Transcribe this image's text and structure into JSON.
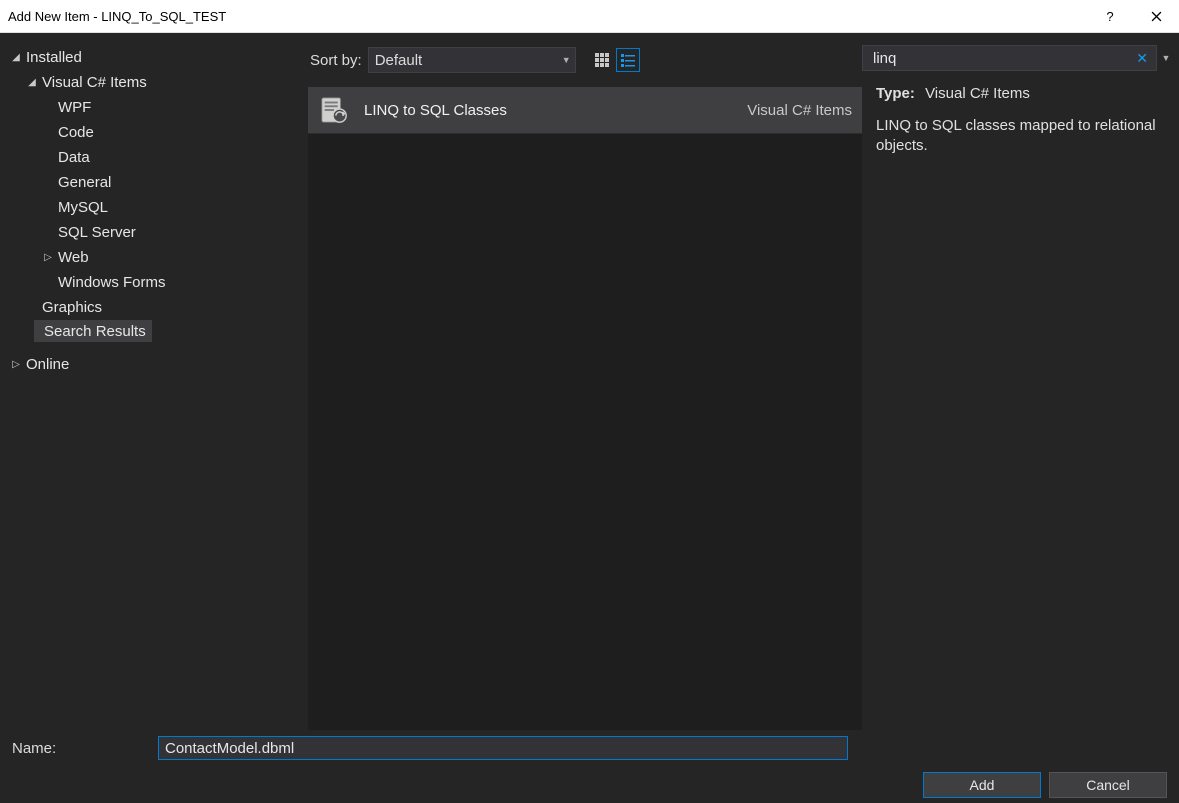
{
  "window": {
    "title": "Add New Item - LINQ_To_SQL_TEST"
  },
  "tree": {
    "installed": "Installed",
    "csharp_items": "Visual C# Items",
    "wpf": "WPF",
    "code": "Code",
    "data": "Data",
    "general": "General",
    "mysql": "MySQL",
    "sql_server": "SQL Server",
    "web": "Web",
    "windows_forms": "Windows Forms",
    "graphics": "Graphics",
    "search_results": "Search Results",
    "online": "Online"
  },
  "toolbar": {
    "sort_label": "Sort by:",
    "sort_value": "Default"
  },
  "template": {
    "name": "LINQ to SQL Classes",
    "lang": "Visual C# Items"
  },
  "search": {
    "value": "linq"
  },
  "details": {
    "type_label": "Type:",
    "type_value": "Visual C# Items",
    "description": "LINQ to SQL classes mapped to relational objects."
  },
  "name_field": {
    "label": "Name:",
    "value": "ContactModel.dbml"
  },
  "buttons": {
    "add": "Add",
    "cancel": "Cancel"
  }
}
